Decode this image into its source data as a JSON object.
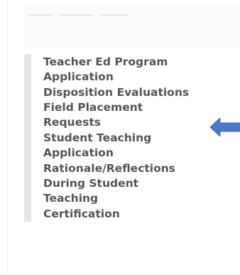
{
  "menu": {
    "items": [
      {
        "label": "Teacher Ed Program\nApplication"
      },
      {
        "label": "Disposition Evaluations"
      },
      {
        "label": "Field Placement\nRequests"
      },
      {
        "label": "Student Teaching\nApplication"
      },
      {
        "label": "Rationale/Reflections"
      },
      {
        "label": "During Student\nTeaching"
      },
      {
        "label": "Certification"
      }
    ]
  },
  "annotation": {
    "arrow_icon": "left-arrow-icon",
    "arrow_color": "#4a79c8"
  }
}
